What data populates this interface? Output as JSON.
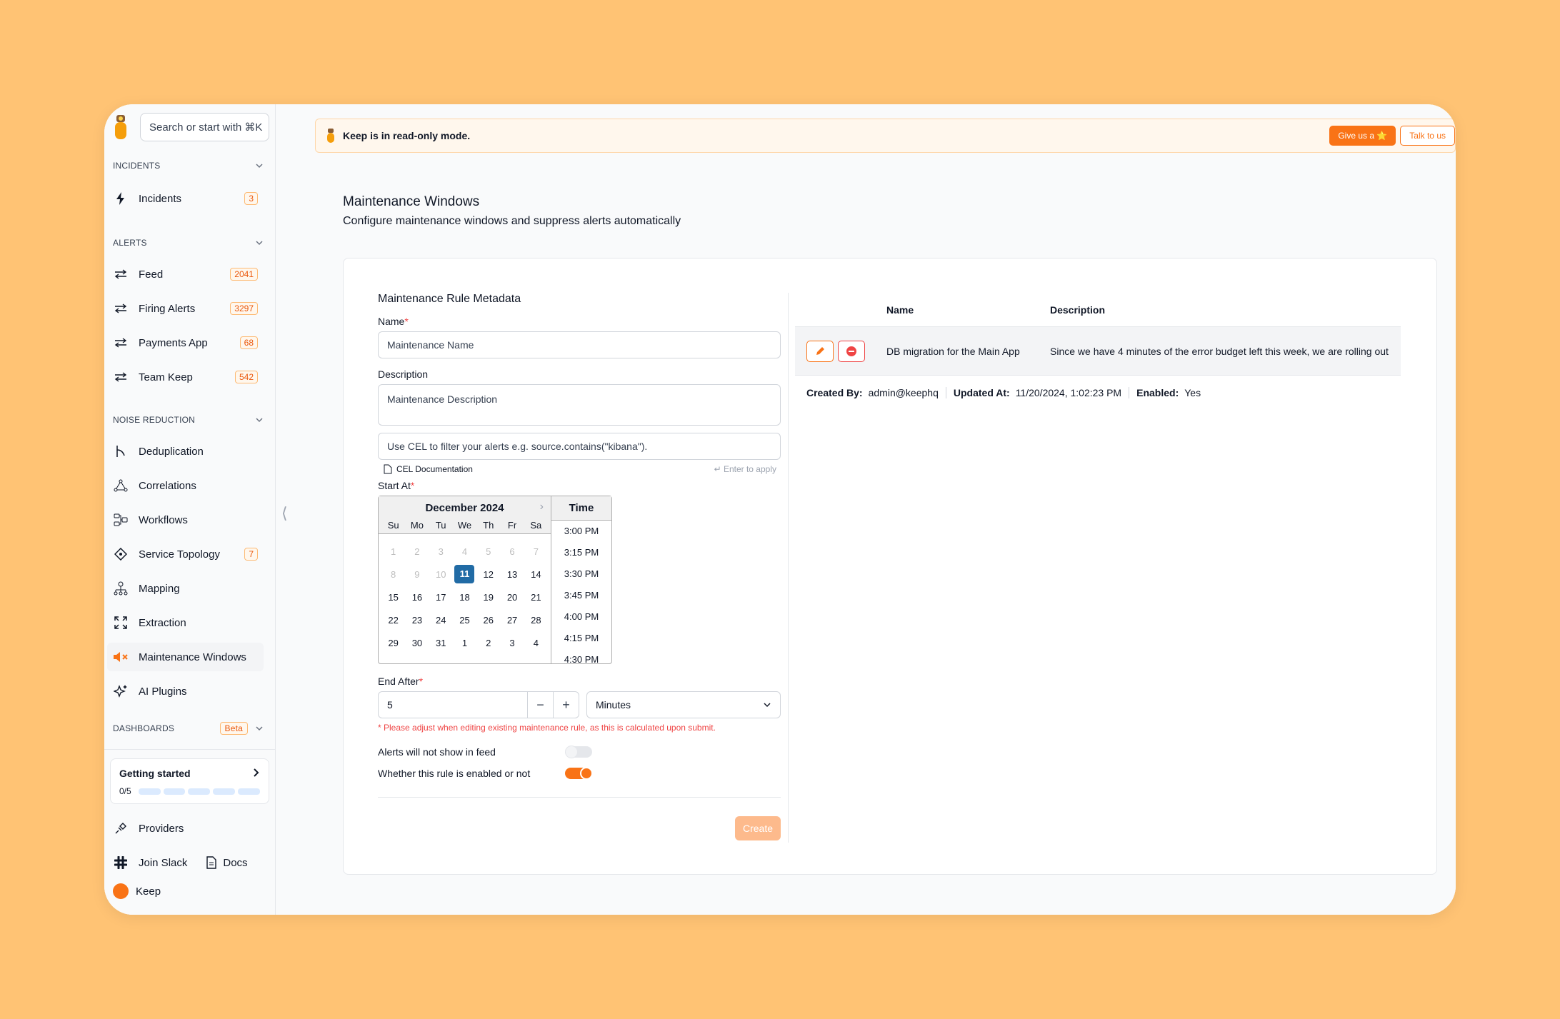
{
  "search": {
    "placeholder": "Search or start with ⌘K"
  },
  "sidebar": {
    "incidents_header": "INCIDENTS",
    "incidents": [
      {
        "label": "Incidents",
        "count": "3",
        "icon": "lightning-icon"
      }
    ],
    "alerts_header": "ALERTS",
    "alerts": [
      {
        "label": "Feed",
        "count": "2041",
        "icon": "arrows-icon"
      },
      {
        "label": "Firing Alerts",
        "count": "3297",
        "icon": "arrows-icon"
      },
      {
        "label": "Payments App",
        "count": "68",
        "icon": "arrows-icon"
      },
      {
        "label": "Team Keep",
        "count": "542",
        "icon": "arrows-icon"
      }
    ],
    "noise_header": "NOISE REDUCTION",
    "noise": [
      {
        "label": "Deduplication",
        "count": "",
        "icon": "merge-icon"
      },
      {
        "label": "Correlations",
        "count": "",
        "icon": "correlations-icon"
      },
      {
        "label": "Workflows",
        "count": "",
        "icon": "workflows-icon"
      },
      {
        "label": "Service Topology",
        "count": "7",
        "icon": "topology-icon"
      },
      {
        "label": "Mapping",
        "count": "",
        "icon": "mapping-icon"
      },
      {
        "label": "Extraction",
        "count": "",
        "icon": "extraction-icon"
      },
      {
        "label": "Maintenance Windows",
        "count": "",
        "icon": "mute-icon"
      },
      {
        "label": "AI Plugins",
        "count": "",
        "icon": "sparkles-icon"
      }
    ],
    "dashboards_header": "DASHBOARDS",
    "beta": "Beta",
    "getting_started": {
      "title": "Getting started",
      "progress": "0/5",
      "completed": 0,
      "total": 5
    },
    "providers": "Providers",
    "join_slack": "Join Slack",
    "docs": "Docs",
    "user": "Keep"
  },
  "banner": {
    "text": "Keep is in read-only mode.",
    "star_button": "Give us a ⭐",
    "talk_button": "Talk to us"
  },
  "page": {
    "title": "Maintenance Windows",
    "subtitle": "Configure maintenance windows and suppress alerts automatically"
  },
  "form": {
    "title": "Maintenance Rule Metadata",
    "name_label": "Name",
    "name_placeholder": "Maintenance Name",
    "description_label": "Description",
    "description_placeholder": "Maintenance Description",
    "cel_placeholder": "Use CEL to filter your alerts e.g. source.contains(\"kibana\").",
    "cel_doc": "CEL Documentation",
    "cel_hint": "↵ Enter to apply",
    "start_label": "Start At",
    "calendar": {
      "month": "December 2024",
      "days_of_week": [
        "Su",
        "Mo",
        "Tu",
        "We",
        "Th",
        "Fr",
        "Sa"
      ],
      "weeks": [
        [
          "1",
          "2",
          "3",
          "4",
          "5",
          "6",
          "7"
        ],
        [
          "8",
          "9",
          "10",
          "11",
          "12",
          "13",
          "14"
        ],
        [
          "15",
          "16",
          "17",
          "18",
          "19",
          "20",
          "21"
        ],
        [
          "22",
          "23",
          "24",
          "25",
          "26",
          "27",
          "28"
        ],
        [
          "29",
          "30",
          "31",
          "1",
          "2",
          "3",
          "4"
        ]
      ],
      "selected": "11",
      "time_header": "Time",
      "times": [
        "3:00 PM",
        "3:15 PM",
        "3:30 PM",
        "3:45 PM",
        "4:00 PM",
        "4:15 PM",
        "4:30 PM"
      ]
    },
    "end_label": "End After",
    "end_value": "5",
    "unit": "Minutes",
    "warning": "* Please adjust when editing existing maintenance rule, as this is calculated upon submit.",
    "toggle_feed_label": "Alerts will not show in feed",
    "toggle_feed_on": false,
    "toggle_enabled_label": "Whether this rule is enabled or not",
    "toggle_enabled_on": true,
    "create_button": "Create"
  },
  "table": {
    "columns": [
      "Name",
      "Description"
    ],
    "rows": [
      {
        "name": "DB migration for the Main App",
        "description": "Since we have 4 minutes of the error budget left this week, we are rolling out"
      }
    ],
    "meta": {
      "created_by_label": "Created By:",
      "created_by": "admin@keephq",
      "updated_at_label": "Updated At:",
      "updated_at": "11/20/2024, 1:02:23 PM",
      "enabled_label": "Enabled:",
      "enabled": "Yes"
    }
  },
  "colors": {
    "accent": "#F97316",
    "background": "#FFC374"
  }
}
